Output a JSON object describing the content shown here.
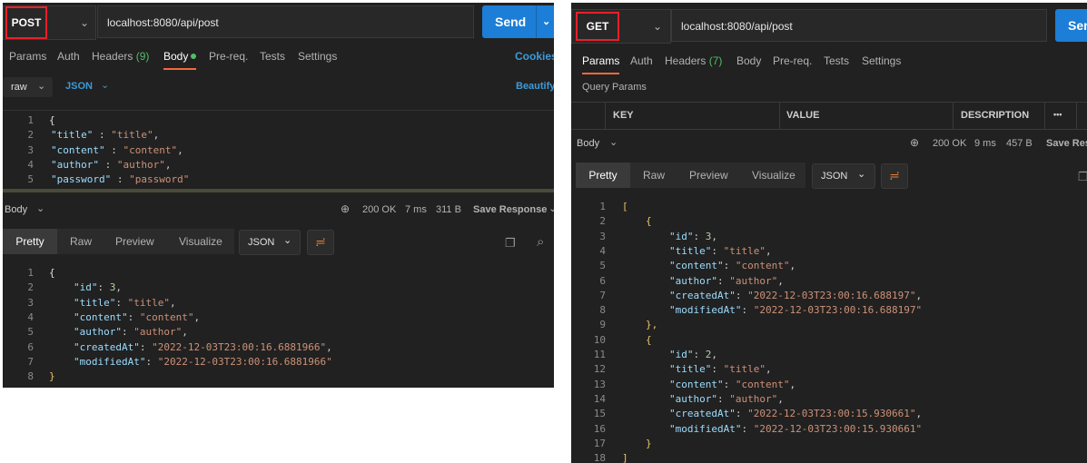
{
  "left": {
    "method": "POST",
    "url": "localhost:8080/api/post",
    "send_label": "Send",
    "tabs": {
      "params": "Params",
      "auth": "Auth",
      "headers": "Headers",
      "headers_count": "(9)",
      "body": "Body",
      "prereq": "Pre-req.",
      "tests": "Tests",
      "settings": "Settings",
      "cookies": "Cookies"
    },
    "body_type": "raw",
    "body_lang": "JSON",
    "beautify": "Beautify",
    "request_lines": [
      "1",
      "2",
      "3",
      "4",
      "5"
    ],
    "request_body": [
      {
        "k": "\"title\"",
        "sep": " : ",
        "v": "\"title\"",
        "end": ","
      },
      {
        "k": "\"content\"",
        "sep": " : ",
        "v": "\"content\"",
        "end": ","
      },
      {
        "k": "\"author\"",
        "sep": " : ",
        "v": "\"author\"",
        "end": ","
      },
      {
        "k": "\"password\"",
        "sep": " : ",
        "v": "\"password\"",
        "end": ""
      }
    ],
    "response": {
      "body_label": "Body",
      "status": "200 OK",
      "time": "7 ms",
      "size": "311 B",
      "save": "Save Response"
    },
    "view_tabs": {
      "pretty": "Pretty",
      "raw": "Raw",
      "preview": "Preview",
      "visualize": "Visualize",
      "format": "JSON"
    },
    "response_lines": [
      "1",
      "2",
      "3",
      "4",
      "5",
      "6",
      "7",
      "8"
    ],
    "response_body": [
      {
        "k": "\"id\"",
        "v": "3"
      },
      {
        "k": "\"title\"",
        "v": "\"title\""
      },
      {
        "k": "\"content\"",
        "v": "\"content\""
      },
      {
        "k": "\"author\"",
        "v": "\"author\""
      },
      {
        "k": "\"createdAt\"",
        "v": "\"2022-12-03T23:00:16.6881966\""
      },
      {
        "k": "\"modifiedAt\"",
        "v": "\"2022-12-03T23:00:16.6881966\""
      }
    ]
  },
  "right": {
    "method": "GET",
    "url": "localhost:8080/api/post",
    "send_label": "Send",
    "tabs": {
      "params": "Params",
      "auth": "Auth",
      "headers": "Headers",
      "headers_count": "(7)",
      "body": "Body",
      "prereq": "Pre-req.",
      "tests": "Tests",
      "settings": "Settings"
    },
    "query_params_title": "Query Params",
    "table_headers": {
      "key": "KEY",
      "value": "VALUE",
      "description": "DESCRIPTION",
      "more": "•••"
    },
    "response": {
      "body_label": "Body",
      "status": "200 OK",
      "time": "9 ms",
      "size": "457 B",
      "save": "Save Response"
    },
    "view_tabs": {
      "pretty": "Pretty",
      "raw": "Raw",
      "preview": "Preview",
      "visualize": "Visualize",
      "format": "JSON"
    },
    "response_lines": [
      "1",
      "2",
      "3",
      "4",
      "5",
      "6",
      "7",
      "8",
      "9",
      "10",
      "11",
      "12",
      "13",
      "14",
      "15",
      "16",
      "17",
      "18"
    ],
    "items": [
      [
        {
          "k": "\"id\"",
          "v": "3"
        },
        {
          "k": "\"title\"",
          "v": "\"title\""
        },
        {
          "k": "\"content\"",
          "v": "\"content\""
        },
        {
          "k": "\"author\"",
          "v": "\"author\""
        },
        {
          "k": "\"createdAt\"",
          "v": "\"2022-12-03T23:00:16.688197\""
        },
        {
          "k": "\"modifiedAt\"",
          "v": "\"2022-12-03T23:00:16.688197\""
        }
      ],
      [
        {
          "k": "\"id\"",
          "v": "2"
        },
        {
          "k": "\"title\"",
          "v": "\"title\""
        },
        {
          "k": "\"content\"",
          "v": "\"content\""
        },
        {
          "k": "\"author\"",
          "v": "\"author\""
        },
        {
          "k": "\"createdAt\"",
          "v": "\"2022-12-03T23:00:15.930661\""
        },
        {
          "k": "\"modifiedAt\"",
          "v": "\"2022-12-03T23:00:15.930661\""
        }
      ]
    ]
  }
}
